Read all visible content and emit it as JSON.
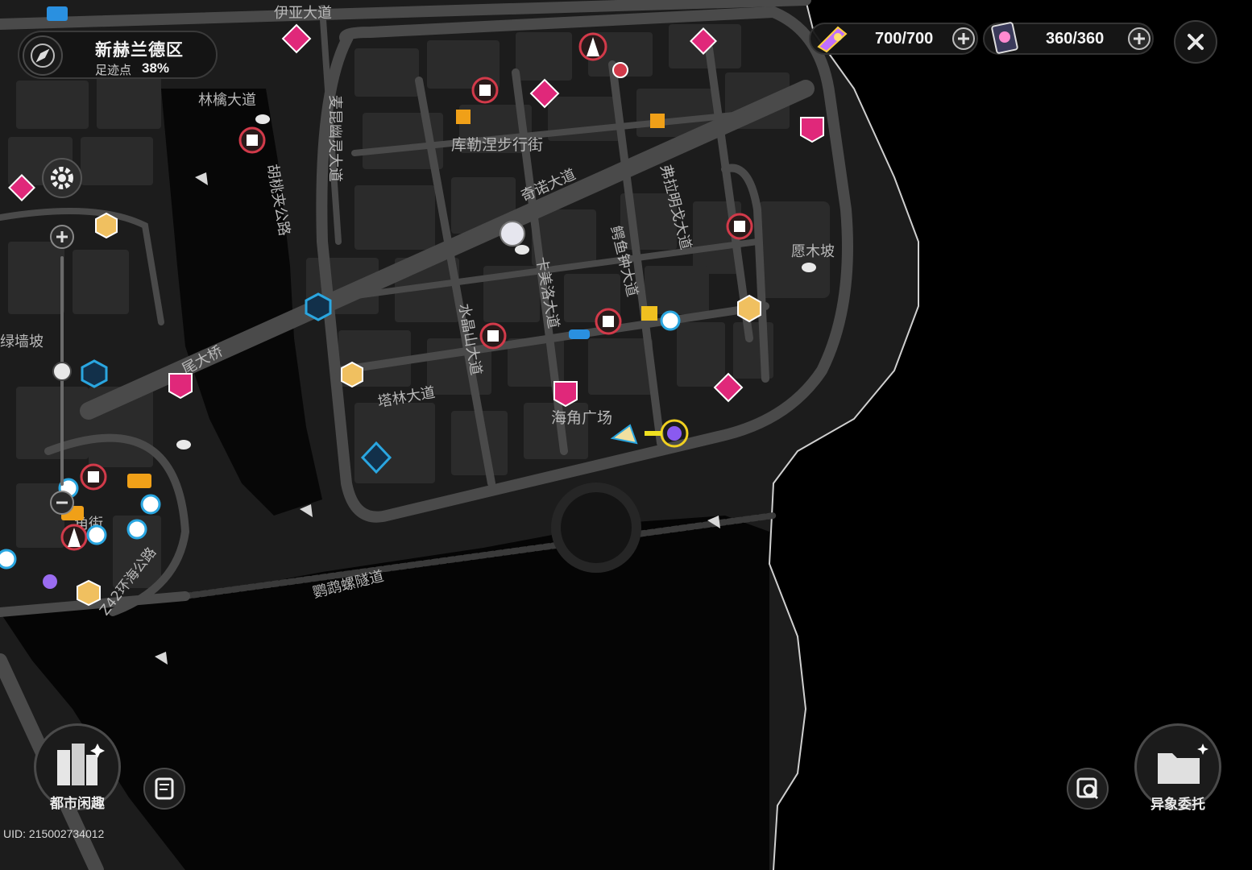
{
  "region": {
    "name": "新赫兰德区",
    "footprint_label": "足迹点",
    "footprint_value": "38%"
  },
  "resources": [
    {
      "name": "battery-energy",
      "value": "700/700"
    },
    {
      "name": "vigor-card",
      "value": "360/360"
    }
  ],
  "bottom": {
    "city_fun_label": "都市闲趣",
    "anomaly_label": "异象委托"
  },
  "uid": "UID: 215002734012",
  "map": {
    "roads": {
      "yiya": "伊亚大道",
      "linqin": "林檎大道",
      "maikun": "麦昆幽灵大道",
      "hutao": "胡桃夹公路",
      "kule": "库勒涅步行街",
      "qinuo": "奇诺大道",
      "fulaming": "弗拉明戈大道",
      "eyu": "鳄鱼钟大道",
      "kameiluo": "卡美洛大道",
      "shuijing": "水晶山大道",
      "talin": "塔林大道",
      "yuanmu": "愿木坡",
      "haijiao": "海角广场",
      "lvqiang": "绿墙坡",
      "weiqiao": "尾大桥",
      "huanhai": "Z42环海公路",
      "yingwu": "鹦鹉螺隧道",
      "jiaojie": "角街"
    }
  },
  "colors": {
    "pink_marker": "#e0287a",
    "red_marker": "#d23a4a",
    "blue_marker": "#2aa6e0",
    "orange_marker": "#f0a018",
    "purple_marker": "#9a6cf0",
    "sea": "#000000",
    "land": "#1d1d1d"
  }
}
